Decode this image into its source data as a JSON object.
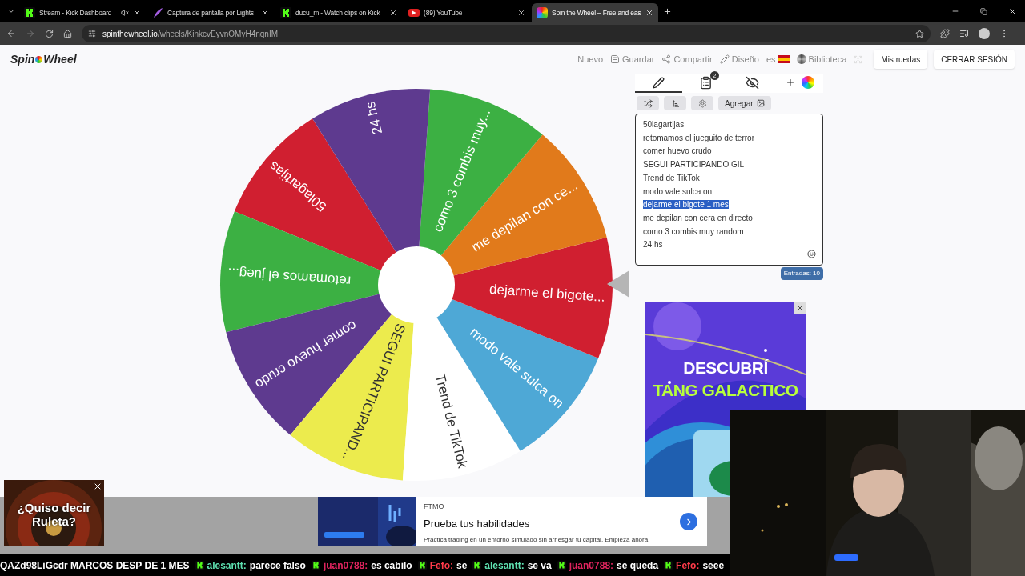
{
  "browser": {
    "tabs": [
      {
        "title": "Stream - Kick Dashboard",
        "kind": "kick",
        "muted": true,
        "selected": false
      },
      {
        "title": "Captura de pantalla por Lights",
        "kind": "lightshot",
        "muted": false,
        "selected": false
      },
      {
        "title": "ducu_m - Watch clips on Kick",
        "kind": "kick",
        "muted": false,
        "selected": false
      },
      {
        "title": "(89) YouTube",
        "kind": "youtube",
        "muted": false,
        "selected": false
      },
      {
        "title": "Spin the Wheel – Free and eas",
        "kind": "wheel",
        "muted": false,
        "selected": true
      }
    ],
    "url_host": "spinthewheel.io",
    "url_path": "/wheels/KinkcvEyvnOMyH4nqnIM"
  },
  "site": {
    "logo_left": "Spin",
    "logo_right": "Wheel",
    "toolbar": [
      {
        "label": "Nuevo",
        "kind": "plain"
      },
      {
        "label": "Guardar",
        "kind": "save"
      },
      {
        "label": "Compartir",
        "kind": "share"
      },
      {
        "label": "Diseño",
        "kind": "design"
      },
      {
        "label": "es",
        "kind": "language"
      },
      {
        "label": "Biblioteca",
        "kind": "library"
      }
    ],
    "buttons": [
      "Mis ruedas",
      "CERRAR SESIÓN"
    ]
  },
  "wheel": {
    "slices": [
      {
        "label": "50lagartijas",
        "color": "#d01f30"
      },
      {
        "label": "retomamos el jueg...",
        "color": "#3cb043"
      },
      {
        "label": "comer huevo crudo",
        "color": "#5e3a8f"
      },
      {
        "label": "SEGUI PARTICIPAND...",
        "color": "#eceb4d"
      },
      {
        "label": "Trend de TikTok",
        "color": "#ffffff"
      },
      {
        "label": "modo vale sulca on",
        "color": "#4ea8d6"
      },
      {
        "label": "dejarme el bigote...",
        "color": "#d01f30"
      },
      {
        "label": "me depilan con ce...",
        "color": "#e17a1b"
      },
      {
        "label": "como 3 combis muy...",
        "color": "#3cb043"
      },
      {
        "label": "24 hs",
        "color": "#5e3a8f"
      }
    ]
  },
  "panel": {
    "tabs": [
      {
        "kind": "edit",
        "selected": true
      },
      {
        "kind": "results",
        "badge": "2",
        "selected": false
      },
      {
        "kind": "hide",
        "selected": false
      },
      {
        "kind": "colors",
        "selected": false
      }
    ],
    "actions": [
      {
        "kind": "shuffle"
      },
      {
        "kind": "sort"
      },
      {
        "kind": "settings"
      },
      {
        "kind": "add",
        "label": "Agregar"
      }
    ],
    "entries": [
      {
        "text": "50lagartijas",
        "selected": false
      },
      {
        "text": "retomamos el jueguito de terror",
        "selected": false
      },
      {
        "text": "comer huevo crudo",
        "selected": false
      },
      {
        "text": "SEGUI PARTICIPANDO GIL",
        "selected": false
      },
      {
        "text": "Trend de TikTok",
        "selected": false
      },
      {
        "text": "modo vale sulca on",
        "selected": false
      },
      {
        "text": "dejarme el bigote 1 mes",
        "selected": true
      },
      {
        "text": "me depilan con cera en directo",
        "selected": false
      },
      {
        "text": "como 3 combis muy random",
        "selected": false
      },
      {
        "text": "24 hs",
        "selected": false
      }
    ],
    "count": "Entradas: 10"
  },
  "side_ad": {
    "line1": "DESCUBRÍ",
    "line2": "TANG GALACTICO"
  },
  "overlay": {
    "popup": {
      "line1": "¿Quiso decir",
      "line2": "Ruleta?"
    },
    "banner_ad": {
      "brand": "FTMO",
      "title": "Prueba tus habilidades",
      "text": "Practica trading en un entorno simulado sin arriesgar tu capital. Empieza ahora."
    },
    "chat": {
      "lead": "QAZd98LiGcdr MARCOS DESP DE 1 MES",
      "messages": [
        {
          "user": "alesantt:",
          "color": "#5ee0b0",
          "text": "parece falso"
        },
        {
          "user": "juan0788:",
          "color": "#e0245e",
          "text": "es cabilo"
        },
        {
          "user": "Fefo:",
          "color": "#ff3b4a",
          "text": "se"
        },
        {
          "user": "alesantt:",
          "color": "#5ee0b0",
          "text": "se va"
        },
        {
          "user": "juan0788:",
          "color": "#e0245e",
          "text": "se queda"
        },
        {
          "user": "Fefo:",
          "color": "#ff3b4a",
          "text": "seee"
        }
      ]
    }
  }
}
